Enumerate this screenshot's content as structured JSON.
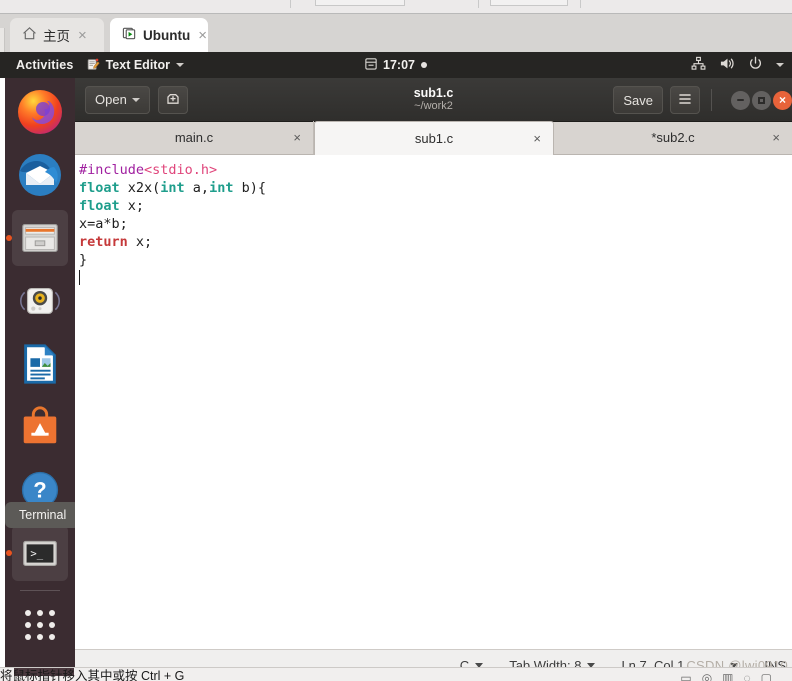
{
  "host_browser": {
    "tabs": [
      {
        "label": "主页",
        "icon": "home-icon",
        "active": false,
        "close": "×"
      },
      {
        "label": "Ubuntu",
        "icon": "vm-screen-icon",
        "active": true,
        "close": "×"
      }
    ]
  },
  "gnome_topbar": {
    "activities": "Activities",
    "app_name": "Text Editor",
    "app_icon": "notepad-pencil-icon",
    "clock": "17:07",
    "clock_icon": "calendar-icon",
    "indicator_icon": "notification-dot-icon",
    "tray": [
      {
        "name": "network-icon"
      },
      {
        "name": "volume-icon"
      },
      {
        "name": "power-icon"
      },
      {
        "name": "chevron-down-icon"
      }
    ]
  },
  "dock": {
    "items": [
      {
        "name": "firefox",
        "label": "Firefox",
        "running": false
      },
      {
        "name": "thunderbird",
        "label": "Thunderbird Mail",
        "running": false
      },
      {
        "name": "files",
        "label": "Files",
        "running": true
      },
      {
        "name": "rhythmbox",
        "label": "Rhythmbox",
        "running": false
      },
      {
        "name": "libreoffice-writer",
        "label": "LibreOffice Writer",
        "running": false
      },
      {
        "name": "ubuntu-software",
        "label": "Ubuntu Software",
        "running": false
      },
      {
        "name": "help",
        "label": "Help",
        "running": false
      },
      {
        "name": "terminal",
        "label": "Terminal",
        "running": true
      }
    ],
    "show_applications_label": "Show Applications"
  },
  "tooltip": {
    "text": "Terminal"
  },
  "gedit": {
    "open_button": "Open",
    "new_document_icon": "new-document-icon",
    "save_button": "Save",
    "menu_icon": "hamburger-menu-icon",
    "title": "sub1.c",
    "subtitle": "~/work2",
    "window_controls": {
      "minimize": "minimize-icon",
      "maximize": "maximize-icon",
      "close": "×"
    },
    "tabs": [
      {
        "label": "main.c",
        "active": false,
        "modified": false,
        "close": "×"
      },
      {
        "label": "sub1.c",
        "active": true,
        "modified": false,
        "close": "×"
      },
      {
        "label": "*sub2.c",
        "active": false,
        "modified": true,
        "close": "×"
      }
    ],
    "code_lines": [
      [
        {
          "t": "#include",
          "c": "tok-pre"
        },
        {
          "t": "<stdio.h>",
          "c": "tok-inc"
        }
      ],
      [
        {
          "t": "float",
          "c": "tok-type"
        },
        {
          "t": " x2x(",
          "c": "tok-plain"
        },
        {
          "t": "int",
          "c": "tok-type"
        },
        {
          "t": " a,",
          "c": "tok-plain"
        },
        {
          "t": "int",
          "c": "tok-type"
        },
        {
          "t": " b){",
          "c": "tok-plain"
        }
      ],
      [
        {
          "t": "float",
          "c": "tok-type"
        },
        {
          "t": " x;",
          "c": "tok-plain"
        }
      ],
      [
        {
          "t": "x=a*b;",
          "c": "tok-plain"
        }
      ],
      [
        {
          "t": "return",
          "c": "tok-kw"
        },
        {
          "t": " x;",
          "c": "tok-plain"
        }
      ],
      [
        {
          "t": "}",
          "c": "tok-plain"
        }
      ],
      []
    ],
    "status": {
      "language": "C",
      "tab_width": "Tab Width: 8",
      "cursor_position": "Ln 7, Col 1",
      "insert_mode": "INS"
    }
  },
  "watermark": {
    "text": "CSDN @lwj0910"
  },
  "host_bottom": {
    "text": "将鼠标指针移入其中或按 Ctrl + G"
  },
  "colors": {
    "ubuntu_orange": "#e95420",
    "topbar_dark": "#262523",
    "dock_bg": "#3b2c31",
    "header_dark": "#3b3a38",
    "tabbar_grey": "#d8d4d0",
    "active_tab": "#f6f5f4",
    "preprocessor": "#a020a0",
    "include_path": "#e0457b",
    "type_keyword": "#1f9e8c",
    "control_keyword": "#c5393a"
  }
}
